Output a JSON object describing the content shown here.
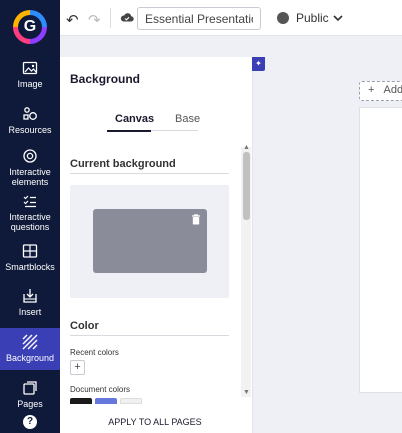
{
  "rail": {
    "items": [
      {
        "label": "Image",
        "icon": "image-icon"
      },
      {
        "label": "Resources",
        "icon": "resources-icon"
      },
      {
        "label": "Interactive elements",
        "icon": "interactive-elements-icon"
      },
      {
        "label": "Interactive questions",
        "icon": "interactive-questions-icon"
      },
      {
        "label": "Smartblocks",
        "icon": "smartblocks-icon"
      },
      {
        "label": "Insert",
        "icon": "insert-icon"
      },
      {
        "label": "Background",
        "icon": "background-icon"
      },
      {
        "label": "Pages",
        "icon": "pages-icon"
      }
    ],
    "help": "?",
    "active": "Background"
  },
  "topbar": {
    "undo": "↶",
    "redo": "↷",
    "title_value": "Essential Presentation",
    "visibility": "Public",
    "caret": "❯"
  },
  "panel": {
    "title": "Background",
    "tabs": [
      {
        "label": "Canvas",
        "active": true
      },
      {
        "label": "Base",
        "active": false
      }
    ],
    "current_background_title": "Current background",
    "current_background_color": "#8a8c9a",
    "color_title": "Color",
    "recent_colors_label": "Recent colors",
    "add_label": "+",
    "document_colors_label": "Document colors",
    "document_colors": [
      "#1a1a1a",
      "#6677dd",
      "#f0f0f0"
    ],
    "apply_label": "APPLY TO ALL PAGES"
  },
  "canvas": {
    "add_label": "Add",
    "add_icon": "+"
  },
  "colors": {
    "rail_bg": "#0f1a3a",
    "accent": "#3a3fb5"
  }
}
